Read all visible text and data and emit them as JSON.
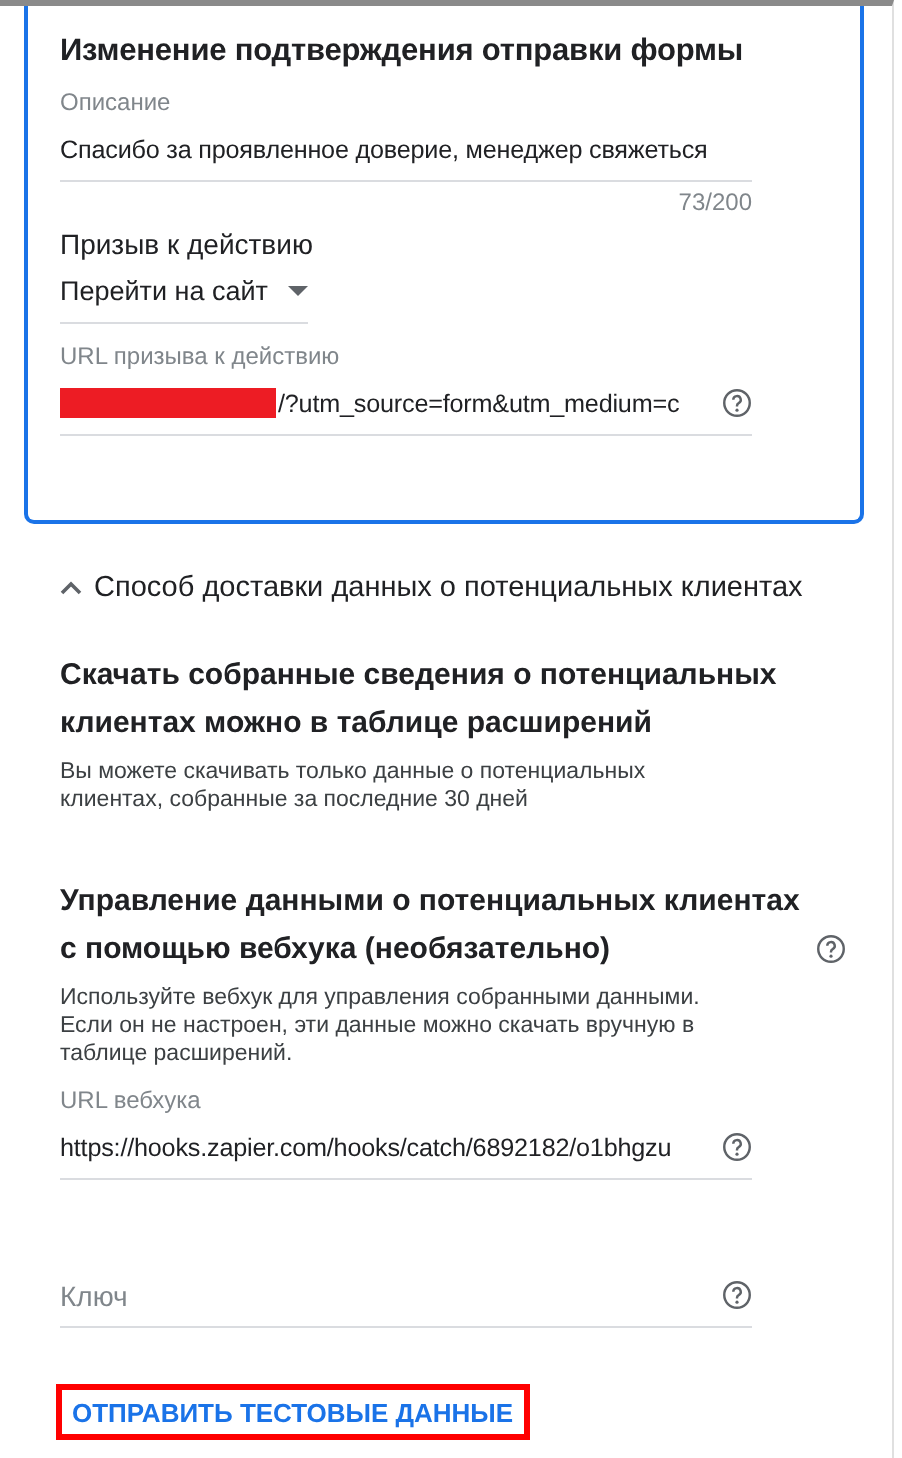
{
  "card": {
    "title": "Изменение подтверждения отправки формы",
    "description_field": {
      "label": "Описание",
      "value": "Спасибо за проявленное доверие, менеджер свяжеться",
      "counter": "73/200"
    },
    "cta": {
      "label": "Призыв к действию",
      "value": "Перейти на сайт"
    },
    "cta_url_field": {
      "label": "URL призыва к действию",
      "value": "/?utm_source=form&utm_medium=c",
      "redacted": true
    }
  },
  "delivery_section": {
    "title": "Способ доставки данных о потенциальных клиентах",
    "expanded": true,
    "download": {
      "heading": "Скачать собранные сведения о потенциальных клиентах можно в таблице расширений",
      "text": "Вы можете скачивать только данные о потенциальных клиентах, собранные за последние 30 дней"
    },
    "webhook": {
      "heading": "Управление данными о потенциальных клиентах с помощью вебхука (необязательно)",
      "text": "Используйте вебхук для управления собранными данными. Если он не настроен, эти данные можно скачать вручную в таблице расширений.",
      "url_field": {
        "label": "URL вебхука",
        "value": "https://hooks.zapier.com/hooks/catch/6892182/o1bhgzu"
      },
      "key_field": {
        "placeholder": "Ключ"
      },
      "test_button": {
        "label": "ОТПРАВИТЬ ТЕСТОВЫЕ ДАННЫЕ",
        "highlighted": true
      }
    }
  }
}
